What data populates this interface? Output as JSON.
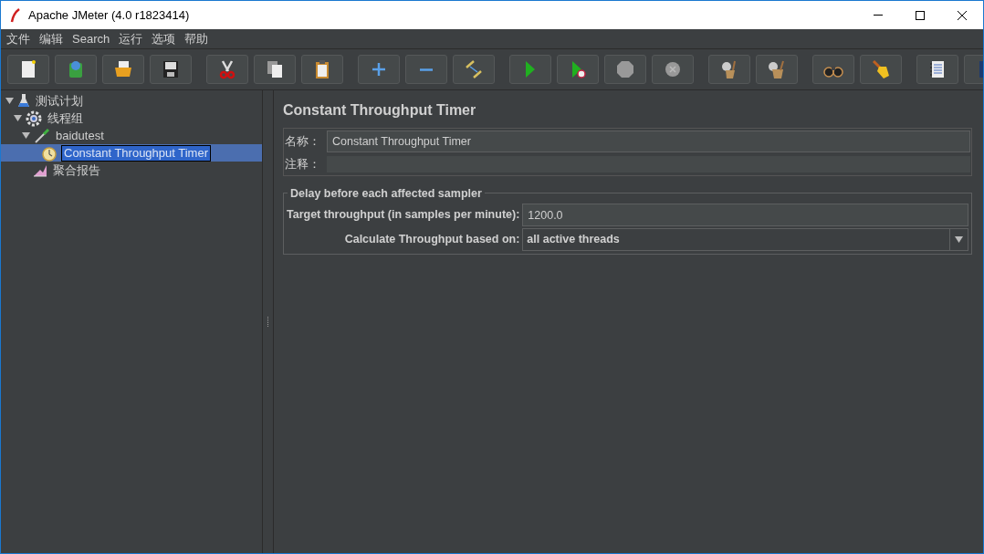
{
  "window": {
    "title": "Apache JMeter (4.0 r1823414)"
  },
  "menu": [
    {
      "label": "文件"
    },
    {
      "label": "编辑"
    },
    {
      "label": "Search"
    },
    {
      "label": "运行"
    },
    {
      "label": "选项"
    },
    {
      "label": "帮助"
    }
  ],
  "tree": [
    {
      "label": "测试计划",
      "kind": "plan",
      "expanded": true,
      "selected": false,
      "children": [
        {
          "label": "线程组",
          "kind": "threads",
          "expanded": true,
          "selected": false,
          "children": [
            {
              "label": "baidutest",
              "kind": "sampler",
              "expanded": true,
              "selected": false,
              "children": [
                {
                  "label": "Constant Throughput Timer",
                  "kind": "timer",
                  "selected": true
                }
              ]
            },
            {
              "label": "聚合报告",
              "kind": "report",
              "selected": false
            }
          ]
        }
      ]
    }
  ],
  "editor": {
    "title": "Constant Throughput Timer",
    "name_field": {
      "label": "名称：",
      "value": "Constant Throughput Timer"
    },
    "comment_field": {
      "label": "注释："
    },
    "group": {
      "title": "Delay before each affected sampler",
      "fields": [
        {
          "kind": "text",
          "label": "Target throughput (in samples per minute):",
          "value": "1200.0"
        },
        {
          "kind": "dropdown",
          "label": "Calculate Throughput based on:",
          "value": "all active threads"
        }
      ]
    }
  }
}
